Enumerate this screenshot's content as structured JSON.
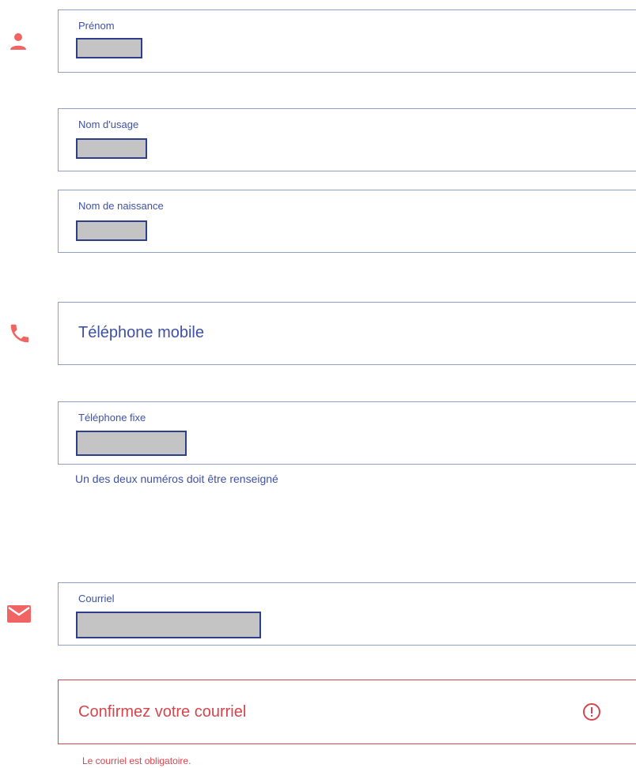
{
  "colors": {
    "accent": "#f06464",
    "border": "#8fa0c4",
    "text": "#3f51a3",
    "error": "#d6454c",
    "mask": "#c4c4c4"
  },
  "fields": {
    "prenom": {
      "label": "Prénom",
      "icon": "person-icon"
    },
    "nom_usage": {
      "label": "Nom d'usage"
    },
    "nom_naissance": {
      "label": "Nom de naissance"
    },
    "tel_mobile": {
      "placeholder": "Téléphone mobile",
      "icon": "phone-icon"
    },
    "tel_fixe": {
      "label": "Téléphone fixe"
    },
    "courriel": {
      "label": "Courriel",
      "icon": "mail-icon"
    },
    "confirm_courriel": {
      "placeholder": "Confirmez votre courriel",
      "error_icon": "alert-circle-icon"
    }
  },
  "phone_helper": "Un des deux numéros doit être renseigné",
  "email_error": "Le courriel est obligatoire."
}
